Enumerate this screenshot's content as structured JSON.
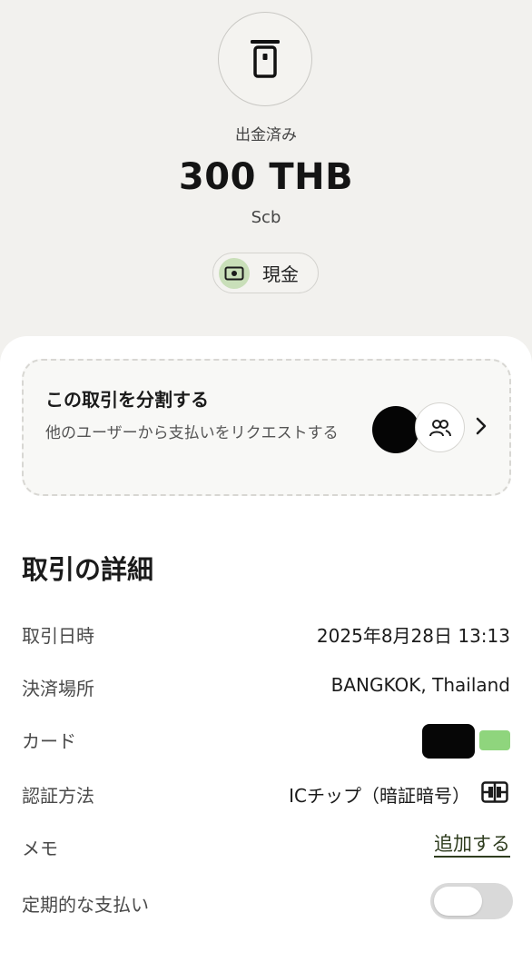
{
  "header": {
    "status": "出金済み",
    "amount": "300 THB",
    "merchant": "Scb",
    "payment_method": "現金",
    "icon": "atm-withdraw-icon"
  },
  "split": {
    "title": "この取引を分割する",
    "description": "他のユーザーから支払いをリクエストする"
  },
  "details": {
    "title": "取引の詳細",
    "rows": {
      "datetime": {
        "label": "取引日時",
        "value": "2025年8月28日 13:13"
      },
      "location": {
        "label": "決済場所",
        "value": "BANGKOK, Thailand"
      },
      "card": {
        "label": "カード"
      },
      "auth": {
        "label": "認証方法",
        "value": "ICチップ（暗証暗号）"
      },
      "memo": {
        "label": "メモ",
        "action": "追加する"
      },
      "recurring": {
        "label": "定期的な支払い",
        "enabled": false
      }
    }
  },
  "colors": {
    "background": "#f2f1ee",
    "sheet": "#ffffff",
    "cash_icon_bg": "#c9dfb9",
    "card_accent": "#8fd57d",
    "link": "#2e3c1e"
  }
}
